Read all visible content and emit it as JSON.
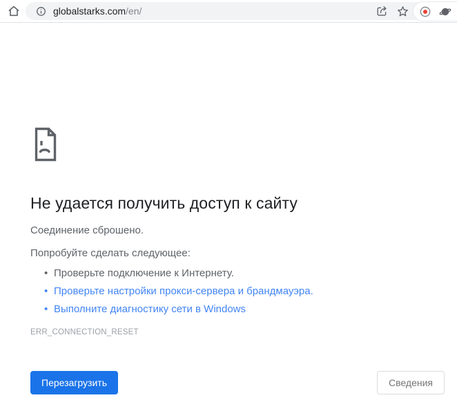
{
  "browser": {
    "url_domain": "globalstarks.com",
    "url_path": "/en/",
    "icons": {
      "home": "home-icon",
      "site_info": "info-icon",
      "share": "share-icon",
      "bookmark": "star-icon",
      "recording": "record-dot-icon",
      "extension": "planet-icon"
    }
  },
  "error_page": {
    "icon": "sad-document-icon",
    "title": "Не удается получить доступ к сайту",
    "message": "Соединение сброшено.",
    "suggestion_intro": "Попробуйте сделать следующее:",
    "suggestions": [
      {
        "text": "Проверьте подключение к Интернету.",
        "is_link": false
      },
      {
        "text": "Проверьте настройки прокси-сервера и брандмауэра.",
        "is_link": true
      },
      {
        "text": "Выполните диагностику сети в Windows",
        "is_link": true
      }
    ],
    "error_code": "ERR_CONNECTION_RESET",
    "reload_button": "Перезагрузить",
    "details_button": "Сведения"
  },
  "colors": {
    "accent_blue": "#1a73e8",
    "link_blue": "#4285f4",
    "record_red": "#ea4335",
    "icon_gray": "#5f6368",
    "text_dark": "#202124",
    "text_gray": "#5f6368",
    "code_gray": "#9aa0a6",
    "omnibox_bg": "#f1f3f4"
  }
}
